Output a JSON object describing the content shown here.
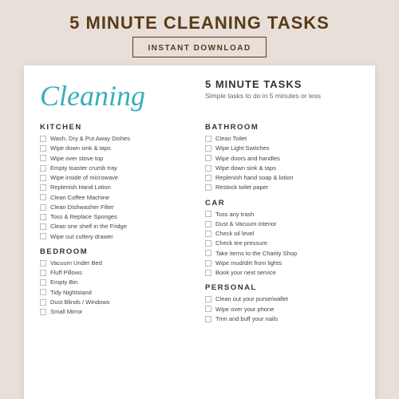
{
  "header": {
    "title": "5 MINUTE CLEANING TASKS",
    "subtitle": "INSTANT DOWNLOAD"
  },
  "card": {
    "script_text": "Cleaning",
    "five_min_title": "5 MINUTE TASKS",
    "five_min_desc": "Simple tasks to do in 5 minutes or less"
  },
  "sections": {
    "kitchen": {
      "title": "KITCHEN",
      "tasks": [
        "Wash, Dry & Put Away Dishes",
        "Wipe down sink & taps",
        "Wipe over stove top",
        "Empty toaster crumb tray",
        "Wipe inside of microwave",
        "Replenish Hand Lotion",
        "Clean Coffee Machine",
        "Clean Dishwasher Filter",
        "Toss & Replace Sponges",
        "Clean one shelf in the Fridge",
        "Wipe out cutlery drawer"
      ]
    },
    "bedroom": {
      "title": "BEDROOM",
      "tasks": [
        "Vacuum Under Bed",
        "Fluff Pillows",
        "Empty Bin",
        "Tidy Nightstand",
        "Dust Blinds / Windows",
        "Small Mirror"
      ]
    },
    "bathroom": {
      "title": "BATHROOM",
      "tasks": [
        "Clean Toilet",
        "Wipe Light Switches",
        "Wipe doors and handles",
        "Wipe down sink & taps",
        "Replenish hand soap & lotion",
        "Restock toilet paper"
      ]
    },
    "car": {
      "title": "CAR",
      "tasks": [
        "Toss any trash",
        "Dust & Vacuum interior",
        "Check oil level",
        "Check tire pressure",
        "Take items to the Charity Shop",
        "Wipe mud/dirt from lights",
        "Book your next service"
      ]
    },
    "personal": {
      "title": "PERSONAL",
      "tasks": [
        "Clean out your purse/wallet",
        "Wipe over your phone",
        "Trim and buff your nails"
      ]
    }
  }
}
